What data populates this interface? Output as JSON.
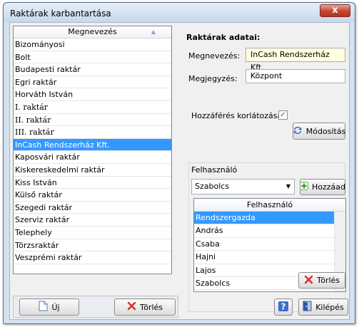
{
  "window": {
    "title": "Raktárak karbantartása",
    "close_glyph": "x"
  },
  "left_list": {
    "header": "Megnevezés",
    "items": [
      "Bizományosi",
      "Bolt",
      "Budapesti raktár",
      "Egri raktár",
      "Horváth István",
      "I. raktár",
      "II. raktár",
      "III. raktár",
      "InCash Rendszerház Kft.",
      "Kaposvári raktár",
      "Kiskereskedelmi raktár",
      "Kiss István",
      "Külső raktár",
      "Szegedi raktár",
      "Szerviz raktár",
      "Telephely",
      "Törzsraktár",
      "Veszprémi raktár"
    ],
    "selected_index": 8
  },
  "details": {
    "title": "Raktárak adatai:",
    "name_label": "Megnevezés:",
    "name_value": "InCash Rendszerház Kft.",
    "note_label": "Megjegyzés:",
    "note_value": "Központ",
    "restrict_label": "Hozzáférés korlátozása",
    "restrict_checked": true,
    "modify_button": "Módosítás"
  },
  "user_group": {
    "label": "Felhasználó",
    "combo_value": "Szabolcs",
    "add_button": "Hozzáad",
    "table_header": "Felhasználó",
    "users": [
      "Rendszergazda",
      "András",
      "Csaba",
      "Hajni",
      "Lajos",
      "Szabolcs"
    ],
    "selected_index": 0,
    "delete_button": "Törlés"
  },
  "bottom": {
    "new_button": "Új",
    "delete_button": "Törlés",
    "help_button": "?",
    "exit_button": "Kilépés"
  },
  "colors": {
    "selection": "#3399ff",
    "window_frame": "#d3e1f0",
    "name_field_bg": "#ffffe0"
  }
}
